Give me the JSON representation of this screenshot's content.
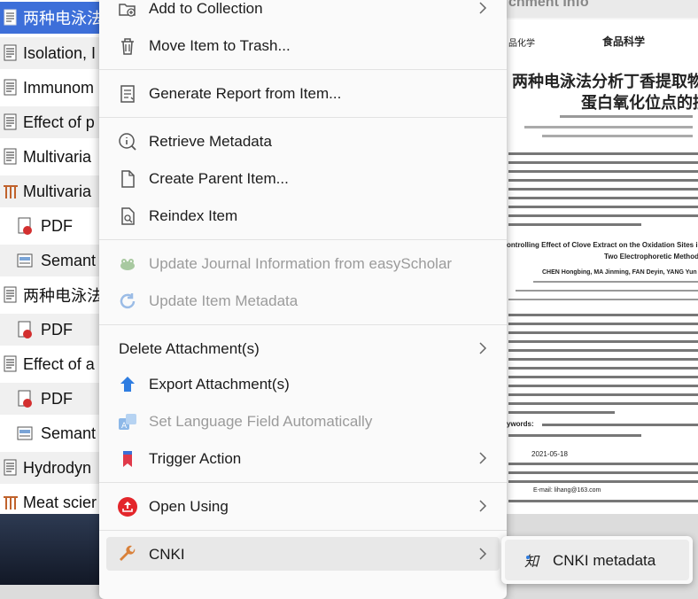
{
  "background_list": {
    "rows": [
      {
        "label": "两种电泳法",
        "type": "journal",
        "selected": true
      },
      {
        "label": "Isolation, I",
        "type": "journal"
      },
      {
        "label": "Immunom",
        "type": "journal"
      },
      {
        "label": "Effect of p",
        "type": "journal"
      },
      {
        "label": "Multivaria",
        "type": "journal"
      },
      {
        "label": "Multivaria",
        "type": "thesis"
      },
      {
        "label": "PDF",
        "type": "pdf",
        "child": true
      },
      {
        "label": "Semant",
        "type": "snapshot",
        "child": true
      },
      {
        "label": "两种电泳法",
        "type": "journal"
      },
      {
        "label": "PDF",
        "type": "pdf",
        "child": true
      },
      {
        "label": "Effect of a",
        "type": "journal"
      },
      {
        "label": "PDF",
        "type": "pdf",
        "child": true
      },
      {
        "label": "Semant",
        "type": "snapshot",
        "child": true
      },
      {
        "label": "Hydrodyn",
        "type": "journal"
      },
      {
        "label": "Meat scier",
        "type": "thesis"
      }
    ]
  },
  "attachment_pane": {
    "header": "chment Info",
    "paper": {
      "journal_left": "品化学",
      "journal_right": "食品科学",
      "title_line1": "两种电泳法分析丁香提取物",
      "title_line2": "蛋白氧化位点的控",
      "en_title": "ontrolling Effect of Clove Extract on the Oxidation Sites in Porcine My",
      "en_subtitle": "Two Electrophoretic Methods",
      "en_authors": "CHEN Hongbing, MA Jinming, FAN Deyin, YANG Yun",
      "keywords_label": "ywords:",
      "date_text": "2021-05-18",
      "email": "E-mail: lihang@163.com"
    }
  },
  "context_menu": {
    "items": [
      {
        "id": "add-to-collection",
        "label": "Add to Collection",
        "icon": "folder-plus-icon",
        "submenu": true
      },
      {
        "id": "move-to-trash",
        "label": "Move Item to Trash...",
        "icon": "trash-icon"
      },
      {
        "id": "generate-report",
        "label": "Generate Report from Item...",
        "icon": "report-icon"
      },
      {
        "id": "retrieve-metadata",
        "label": "Retrieve Metadata",
        "icon": "info-search-icon"
      },
      {
        "id": "create-parent",
        "label": "Create Parent Item...",
        "icon": "document-icon"
      },
      {
        "id": "reindex-item",
        "label": "Reindex Item",
        "icon": "document-search-icon"
      },
      {
        "id": "update-journal-info",
        "label": "Update Journal Information from easyScholar",
        "icon": "frog-icon",
        "disabled": true
      },
      {
        "id": "update-item-metadata",
        "label": "Update Item Metadata",
        "icon": "refresh-icon",
        "disabled": true
      },
      {
        "id": "delete-attachments",
        "label": "Delete Attachment(s)",
        "icon": "",
        "submenu": true
      },
      {
        "id": "export-attachments",
        "label": "Export Attachment(s)",
        "icon": "export-arrow-icon"
      },
      {
        "id": "set-language",
        "label": "Set Language Field Automatically",
        "icon": "translate-icon",
        "disabled": true
      },
      {
        "id": "trigger-action",
        "label": "Trigger Action",
        "icon": "bookmark-icon",
        "submenu": true
      },
      {
        "id": "open-using",
        "label": "Open Using",
        "icon": "open-external-icon",
        "submenu": true
      },
      {
        "id": "cnki",
        "label": "CNKI",
        "icon": "wrench-icon",
        "submenu": true,
        "hover": true
      }
    ]
  },
  "submenu": {
    "items": [
      {
        "label": "CNKI metadata",
        "icon": "cnki-icon"
      }
    ]
  },
  "colors": {
    "selection": "#3d6fd9",
    "menu_bg": "#fafafa",
    "disabled_text": "#9b9b9b",
    "hover_bg": "#e8e8e8",
    "trigger_action_red": "#e0394a",
    "open_using_red": "#e3262b",
    "export_blue": "#2f7de1",
    "wrench_orange": "#d9813a"
  }
}
